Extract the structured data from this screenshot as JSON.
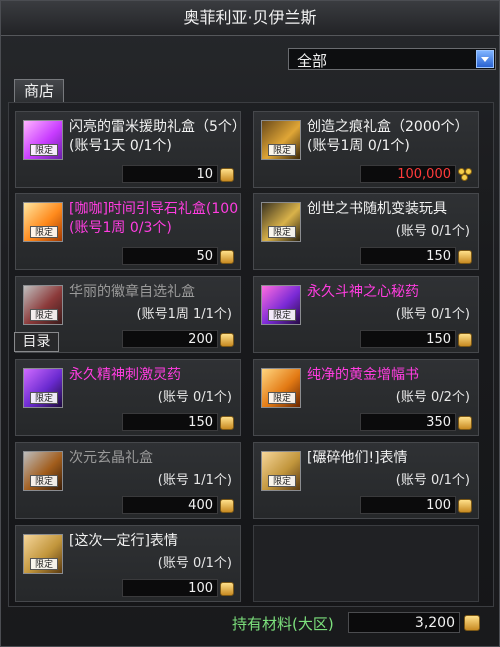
{
  "window": {
    "title": "奥菲利亚·贝伊兰斯"
  },
  "filter": {
    "selected": "全部"
  },
  "tabs": {
    "shop": "商店"
  },
  "overlay": {
    "catalog_label": "目录"
  },
  "items": [
    {
      "name": "闪亮的雷米援助礼盒（5个）(账号1天 0/1个)",
      "limit": "",
      "price": "10",
      "badge": "限定",
      "name_color": "#f2f2f2",
      "price_red": false
    },
    {
      "name": "创造之痕礼盒（2000个）(账号1周 0/1个)",
      "limit": "",
      "price": "100,000",
      "badge": "限定",
      "name_color": "#f2f2f2",
      "price_red": true
    },
    {
      "name": "[咖咖]时间引导石礼盒(100 (账号1周 0/3个)",
      "limit": "",
      "price": "50",
      "badge": "限定",
      "name_color": "#ff3de0",
      "price_red": false
    },
    {
      "name": "创世之书随机变装玩具",
      "limit": "(账号 0/1个)",
      "price": "150",
      "badge": "限定",
      "name_color": "#f2f2f2",
      "price_red": false
    },
    {
      "name": "华丽的徽章自选礼盒",
      "limit": "(账号1周 1/1个)",
      "price": "200",
      "badge": "限定",
      "name_color": "#9a9a9a",
      "price_red": false
    },
    {
      "name": "永久斗神之心秘药",
      "limit": "(账号 0/1个)",
      "price": "150",
      "badge": "限定",
      "name_color": "#ff3de0",
      "price_red": false
    },
    {
      "name": "永久精神刺激灵药",
      "limit": "(账号 0/1个)",
      "price": "150",
      "badge": "限定",
      "name_color": "#ff3de0",
      "price_red": false
    },
    {
      "name": "纯净的黄金增幅书",
      "limit": "(账号 0/2个)",
      "price": "350",
      "badge": "限定",
      "name_color": "#ff3de0",
      "price_red": false
    },
    {
      "name": "次元玄晶礼盒",
      "limit": "(账号 1/1个)",
      "price": "400",
      "badge": "限定",
      "name_color": "#9a9a9a",
      "price_red": false
    },
    {
      "name": "[碾碎他们!]表情",
      "limit": "(账号 0/1个)",
      "price": "100",
      "badge": "限定",
      "name_color": "#f2f2f2",
      "price_red": false
    },
    {
      "name": "[这次一定行]表情",
      "limit": "(账号 0/1个)",
      "price": "100",
      "badge": "限定",
      "name_color": "#f2f2f2",
      "price_red": false
    }
  ],
  "footer": {
    "label": "持有材料(大区)",
    "value": "3,200"
  }
}
